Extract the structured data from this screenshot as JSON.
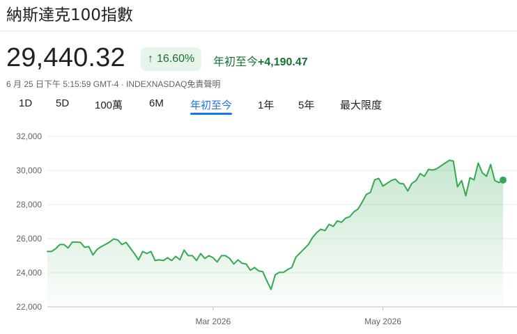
{
  "header": {
    "title": "納斯達克100指數",
    "price": "29,440.32",
    "badge": "16.60%",
    "change_label": "年初至今",
    "change_value": "+4,190.47",
    "meta": "6 月 25 日下午 5:15:59 GMT-4 · INDEXNASDAQ免責聲明"
  },
  "tabs": [
    {
      "label": "1D",
      "active": false
    },
    {
      "label": "5D",
      "active": false
    },
    {
      "label": "100萬",
      "active": false
    },
    {
      "label": "6M",
      "active": false
    },
    {
      "label": "年初至今",
      "active": true
    },
    {
      "label": "1年",
      "active": false
    },
    {
      "label": "5年",
      "active": false
    },
    {
      "label": "最大限度",
      "active": false
    }
  ],
  "colors": {
    "line": "#34a853",
    "positive_text": "#137333",
    "badge_bg": "#e6f4ea",
    "active_tab": "#1a73e8"
  },
  "chart_data": {
    "type": "area",
    "ylim": [
      22000,
      32000
    ],
    "yticks": [
      "22,000",
      "24,000",
      "26,000",
      "28,000",
      "30,000",
      "32,000"
    ],
    "ytick_values": [
      22000,
      24000,
      26000,
      28000,
      30000,
      32000
    ],
    "xticks": [
      {
        "label": "Mar 2026",
        "index": 40
      },
      {
        "label": "May 2026",
        "index": 81
      }
    ],
    "grid": true,
    "values": [
      25249,
      25249,
      25412,
      25657,
      25657,
      25453,
      25800,
      25800,
      25780,
      25493,
      25535,
      25045,
      25372,
      25535,
      25657,
      25800,
      25984,
      25922,
      25657,
      25780,
      25453,
      25126,
      24759,
      25249,
      25126,
      25249,
      24718,
      24759,
      24718,
      24882,
      24718,
      24963,
      24759,
      25331,
      25004,
      25004,
      24718,
      25126,
      24841,
      25004,
      24882,
      24636,
      25004,
      25004,
      24841,
      24514,
      24759,
      24555,
      24514,
      24146,
      24310,
      24106,
      24065,
      23514,
      23024,
      23881,
      24024,
      24024,
      24188,
      24310,
      24922,
      25167,
      25412,
      25657,
      26065,
      26351,
      26555,
      26473,
      26841,
      26718,
      27045,
      26963,
      27208,
      27290,
      27576,
      27739,
      28147,
      28596,
      28720,
      29453,
      29535,
      29086,
      29249,
      29412,
      29494,
      29249,
      29208,
      28800,
      29249,
      29412,
      29820,
      29657,
      30065,
      30024,
      30106,
      30269,
      30433,
      30596,
      30555,
      29045,
      29412,
      28515,
      29576,
      29453,
      30433,
      29862,
      29657,
      30351,
      29412,
      29290,
      29440
    ]
  }
}
